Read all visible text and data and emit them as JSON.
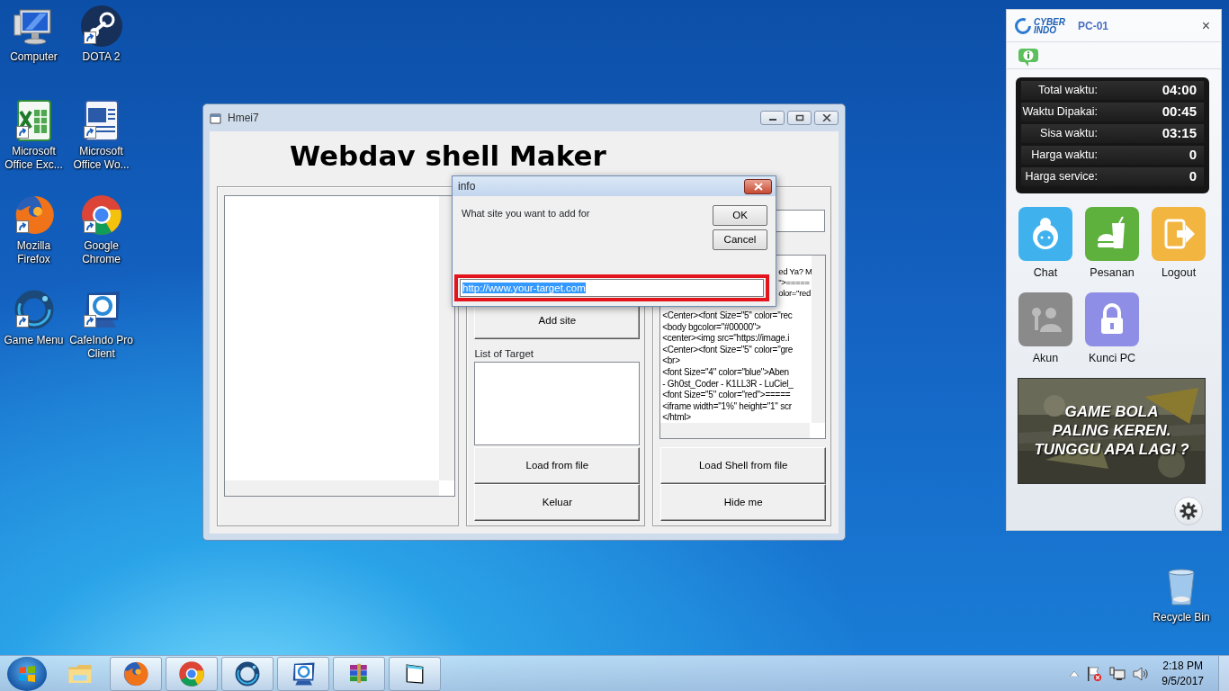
{
  "desktop_icons": [
    {
      "label": "Computer",
      "kind": "computer",
      "shortcut": false
    },
    {
      "label": "DOTA 2",
      "kind": "roundlogo",
      "shortcut": true
    },
    {
      "label": "Microsoft Office Exc...",
      "kind": "spreadsheet",
      "shortcut": true
    },
    {
      "label": "Microsoft Office Wo...",
      "kind": "document",
      "shortcut": true
    },
    {
      "label": "Mozilla Firefox",
      "kind": "firefox",
      "shortcut": true
    },
    {
      "label": "Google Chrome",
      "kind": "chrome",
      "shortcut": true
    },
    {
      "label": "Game Menu",
      "kind": "ring",
      "shortcut": true
    },
    {
      "label": "CafeIndo Pro Client",
      "kind": "cafe",
      "shortcut": true
    }
  ],
  "recycle_bin": {
    "label": "Recycle Bin"
  },
  "app_window": {
    "title": "Hmei7",
    "heading": "Webdav shell Maker",
    "add_site_button": "Add site",
    "target_list_label": "List of Target",
    "middle_buttons": [
      "Load from file",
      "Keluar"
    ],
    "shell_lines": [
      {
        "kind": "partial",
        "text": "ed Ya? M"
      },
      {
        "kind": "partial",
        "text": "\">====="
      },
      {
        "kind": "partial",
        "text": "olor=\"red"
      },
      {
        "kind": "full",
        "text": "<Center><font Size=\"5\" color=\"rec"
      },
      {
        "kind": "full",
        "text": "<body bgcolor=\"#00000\">"
      },
      {
        "kind": "full",
        "text": "<center><img src=\"https://image.i"
      },
      {
        "kind": "full",
        "text": "<Center><font Size=\"5\" color=\"gre"
      },
      {
        "kind": "full",
        "text": "<br>"
      },
      {
        "kind": "full",
        "text": "<font Size=\"4\" color=\"blue\">Aben"
      },
      {
        "kind": "full",
        "text": " - Gh0st_Coder - K1LL3R - LuCiel_"
      },
      {
        "kind": "full",
        "text": "<font Size=\"5\" color=\"red\">====="
      },
      {
        "kind": "full",
        "text": "<iframe width=\"1%\" height=\"1\" scr"
      },
      {
        "kind": "full",
        "text": "</html>"
      }
    ],
    "right_buttons": [
      "Load Shell from file",
      "Hide me"
    ]
  },
  "dialog": {
    "title": "info",
    "prompt": "What site you want to add for",
    "buttons": [
      "OK",
      "Cancel"
    ],
    "input": {
      "value": "http://www.your-target.com",
      "selected": true
    }
  },
  "client_panel": {
    "logo_lines": [
      "CYBER",
      "INDO"
    ],
    "pc_name": "PC-01",
    "close": "×",
    "stats": [
      {
        "label": "Total waktu:",
        "value": "04:00"
      },
      {
        "label": "Waktu Dipakai:",
        "value": "00:45"
      },
      {
        "label": "Sisa waktu:",
        "value": "03:15"
      },
      {
        "label": "Harga waktu:",
        "value": "0"
      },
      {
        "label": "Harga service:",
        "value": "0"
      }
    ],
    "tiles": [
      {
        "label": "Chat",
        "kind": "chat",
        "color": "#3fb2ee"
      },
      {
        "label": "Pesanan",
        "kind": "food",
        "color": "#5fb13e"
      },
      {
        "label": "Logout",
        "kind": "logout",
        "color": "#f2b53f"
      },
      {
        "label": "Akun",
        "kind": "account",
        "color": "#8a8a8a"
      },
      {
        "label": "Kunci PC",
        "kind": "lock",
        "color": "#8f8ee6"
      }
    ],
    "banner_lines": [
      "GAME BOLA",
      "PALING KEREN.",
      "TUNGGU APA LAGI ?"
    ]
  },
  "taskbar": {
    "apps": [
      {
        "kind": "explorer",
        "running": false
      },
      {
        "kind": "firefox",
        "running": true
      },
      {
        "kind": "chrome",
        "running": true
      },
      {
        "kind": "ring",
        "running": true
      },
      {
        "kind": "cafe",
        "running": true
      },
      {
        "kind": "archive",
        "running": true
      },
      {
        "kind": "window",
        "running": true
      }
    ],
    "clock": {
      "time": "2:18 PM",
      "date": "9/5/2017"
    }
  }
}
